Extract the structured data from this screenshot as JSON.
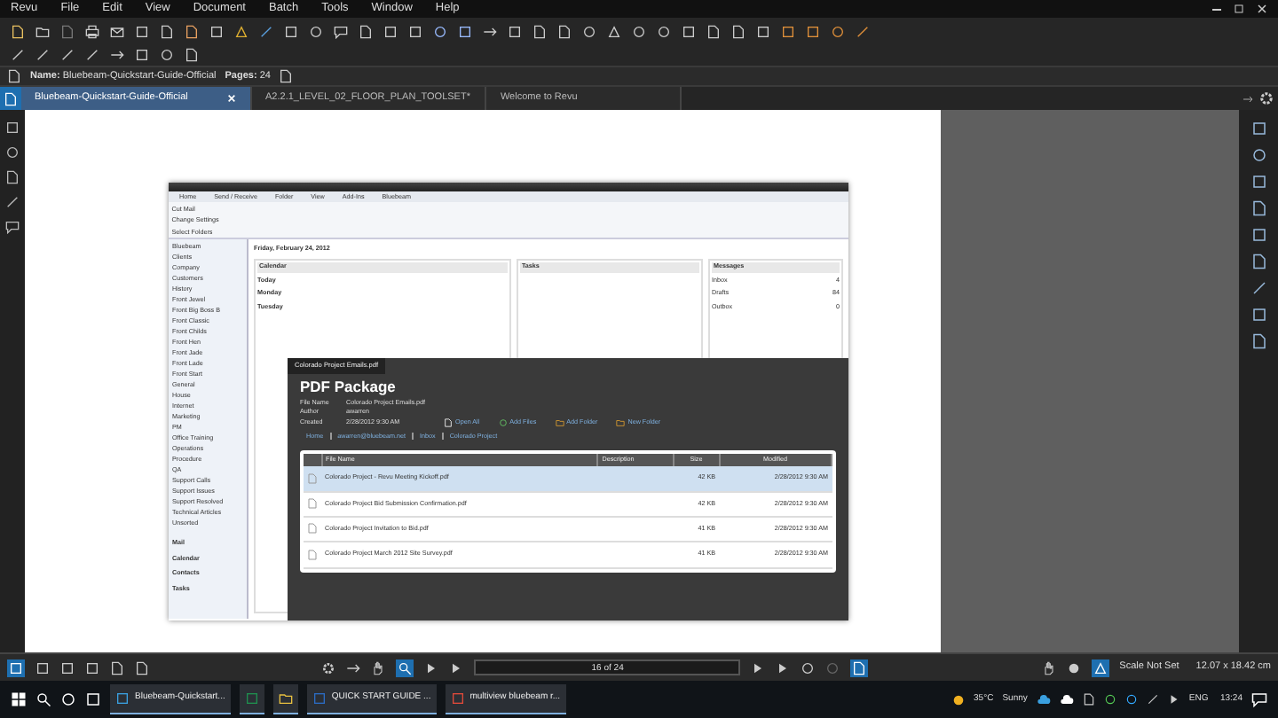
{
  "menu": [
    "Revu",
    "File",
    "Edit",
    "View",
    "Document",
    "Batch",
    "Tools",
    "Window",
    "Help"
  ],
  "properties": {
    "name_label": "Name:",
    "name": "Bluebeam-Quickstart-Guide-Official",
    "pages_label": "Pages:",
    "pages": "24"
  },
  "tabs": [
    {
      "label": "Bluebeam-Quickstart-Guide-Official",
      "selected": true
    },
    {
      "label": "A2.2.1_LEVEL_02_FLOOR_PLAN_TOOLSET*",
      "selected": false
    },
    {
      "label": "Welcome to Revu",
      "selected": false
    }
  ],
  "document": {
    "outlook": {
      "ribbon_tabs": [
        "Home",
        "Send / Receive",
        "Folder",
        "View",
        "Add-Ins",
        "Bluebeam"
      ],
      "ribbon_items": [
        "Cut Mail",
        "Change Settings",
        "Select Folders"
      ],
      "folders": [
        "Bluebeam",
        "Clients",
        "Company",
        "Customers",
        "History",
        "Front Jewel",
        "Front Big Boss B",
        "Front Classic",
        "Front Childs",
        "Front Hen",
        "Front Jade",
        "Front Lade",
        "Front Start",
        "General",
        "House",
        "Internet",
        "Marketing",
        "PM",
        "Office Training",
        "Operations",
        "Procedure",
        "QA",
        "Support Calls",
        "Support Issues",
        "Support Resolved",
        "Technical Articles",
        "Unsorted"
      ],
      "nav": [
        "Mail",
        "Calendar",
        "Contacts",
        "Tasks"
      ],
      "date": "Friday, February 24, 2012",
      "calendar": "Calendar",
      "days": [
        "Today",
        "Monday",
        "Tuesday"
      ],
      "tasks": "Tasks",
      "messages": "Messages",
      "counts": [
        {
          "label": "Inbox",
          "value": "4"
        },
        {
          "label": "Drafts",
          "value": "84"
        },
        {
          "label": "Outbox",
          "value": "0"
        }
      ]
    },
    "package": {
      "tab": "Colorado Project Emails.pdf",
      "title": "PDF Package",
      "fields": [
        {
          "label": "File Name",
          "value": "Colorado Project Emails.pdf"
        },
        {
          "label": "Author",
          "value": "awarren"
        },
        {
          "label": "Created",
          "value": "2/28/2012 9:30 AM"
        }
      ],
      "actions": [
        "Open All",
        "Add Files",
        "Add Folder",
        "New Folder"
      ],
      "breadcrumb": [
        "Home",
        "awarren@bluebeam.net",
        "Inbox",
        "Colorado Project"
      ],
      "columns": [
        "File Name",
        "Description",
        "Size",
        "Modified"
      ],
      "rows": [
        {
          "name": "Colorado Project - Revu Meeting Kickoff.pdf",
          "size": "42 KB",
          "modified": "2/28/2012 9:30 AM",
          "selected": true
        },
        {
          "name": "Colorado Project Bid Submission Confirmation.pdf",
          "size": "42 KB",
          "modified": "2/28/2012 9:30 AM",
          "selected": false
        },
        {
          "name": "Colorado Project Invitation to Bid.pdf",
          "size": "41 KB",
          "modified": "2/28/2012 9:30 AM",
          "selected": false
        },
        {
          "name": "Colorado Project March 2012 Site Survey.pdf",
          "size": "41 KB",
          "modified": "2/28/2012 9:30 AM",
          "selected": false
        }
      ]
    }
  },
  "status": {
    "page": "16 of 24",
    "scale": "Scale Not Set",
    "size": "12.07 x 18.42 cm"
  },
  "taskbar": {
    "items": [
      {
        "kind": "bluebeam",
        "label": "Bluebeam-Quickstart..."
      },
      {
        "kind": "excel"
      },
      {
        "kind": "folder"
      },
      {
        "kind": "word",
        "label": "QUICK START GUIDE ..."
      },
      {
        "kind": "chrome",
        "label": "multiview bluebeam r..."
      }
    ],
    "weather": "35°C",
    "condition": "Sunny",
    "lang": "ENG",
    "time": "13:24"
  }
}
